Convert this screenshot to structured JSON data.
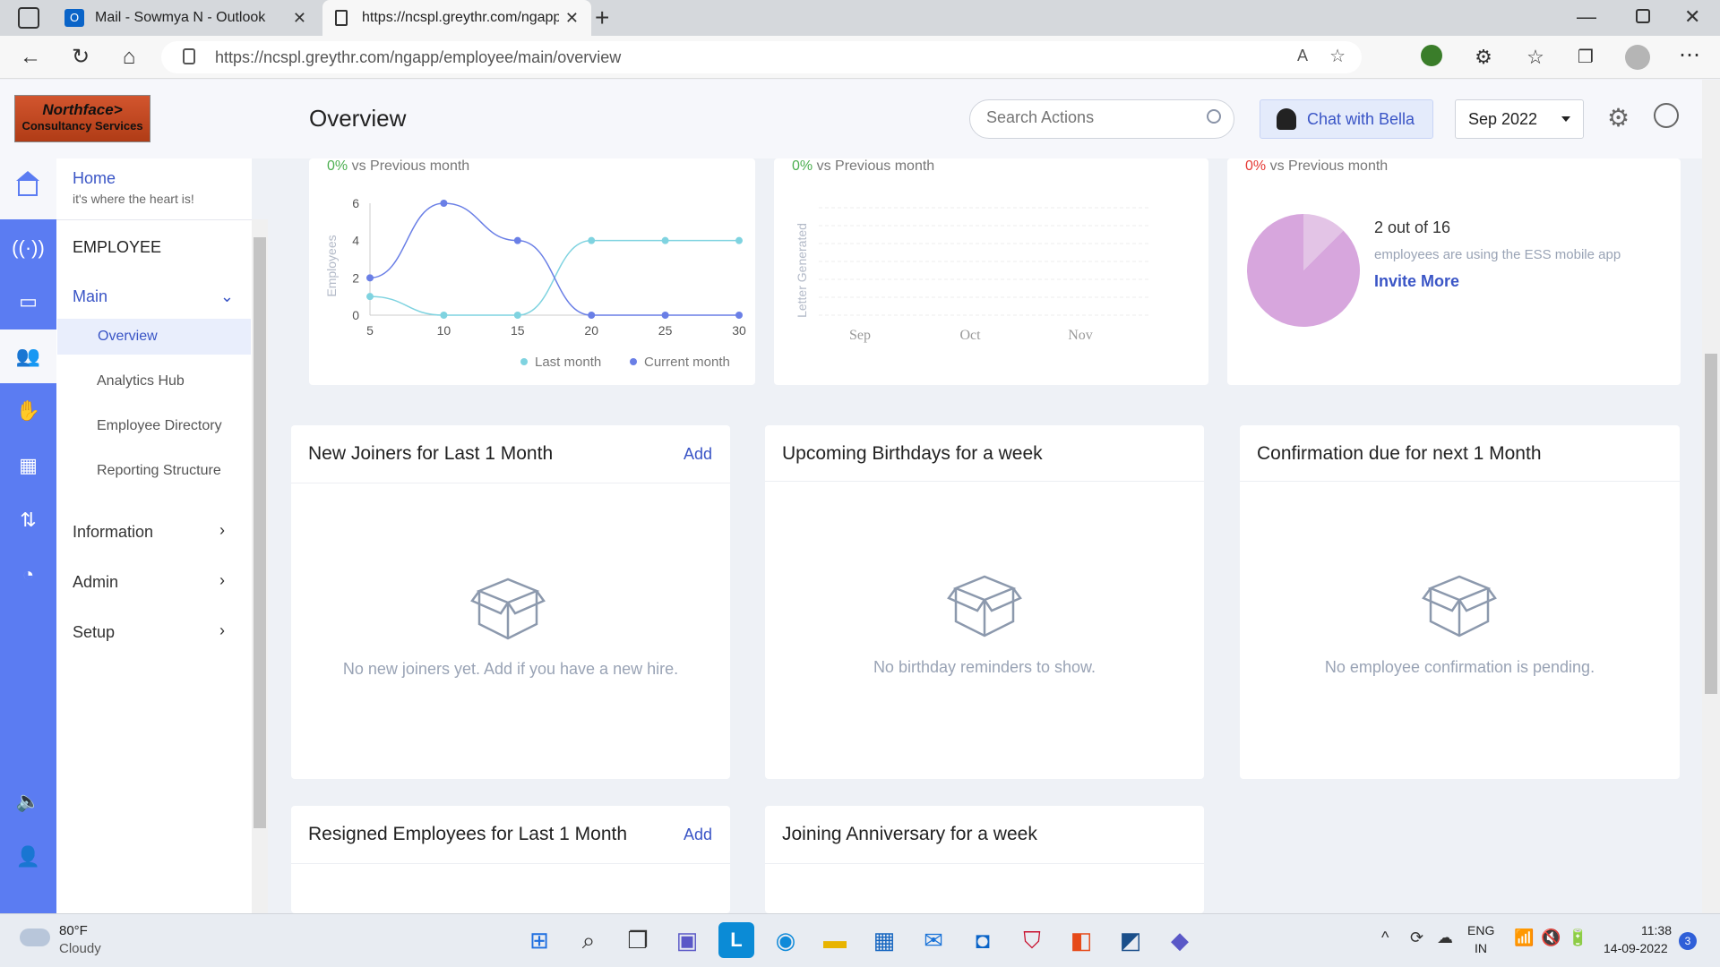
{
  "browser": {
    "tabs": [
      {
        "title": "Mail - Sowmya N - Outlook"
      },
      {
        "title": "https://ncspl.greythr.com/ngapp"
      }
    ],
    "url": "https://ncspl.greythr.com/ngapp/employee/main/overview"
  },
  "header": {
    "logo_line1": "Northface>",
    "logo_line2": "Consultancy Services",
    "title": "Overview",
    "search_placeholder": "Search Actions",
    "chat_label": "Chat with Bella",
    "month_select": "Sep 2022"
  },
  "sidebar": {
    "home_label": "Home",
    "home_sub": "it's where the heart is!",
    "section": "EMPLOYEE",
    "main_label": "Main",
    "items": [
      "Overview",
      "Analytics Hub",
      "Employee Directory",
      "Reporting Structure"
    ],
    "groups": [
      "Information",
      "Admin",
      "Setup"
    ]
  },
  "stats": [
    {
      "pct": "0%",
      "suffix": "vs Previous month",
      "color": "#4caf50"
    },
    {
      "pct": "0%",
      "suffix": "vs Previous month",
      "color": "#4caf50"
    },
    {
      "pct": "0%",
      "suffix": "vs Previous month",
      "color": "#e53935"
    }
  ],
  "chart_data": [
    {
      "type": "line",
      "ylabel": "Employees",
      "x": [
        5,
        10,
        15,
        20,
        25,
        30
      ],
      "yticks": [
        0,
        2,
        4,
        6
      ],
      "ylim": [
        0,
        6
      ],
      "series": [
        {
          "name": "Last month",
          "color": "#7fd3e0",
          "values": [
            1,
            0,
            0,
            4,
            4,
            4
          ]
        },
        {
          "name": "Current month",
          "color": "#6a7fe6",
          "values": [
            2,
            6,
            4,
            0,
            0,
            0
          ]
        }
      ],
      "legend": "bottom-right"
    },
    {
      "type": "bar",
      "ylabel": "Letter Generated",
      "categories": [
        "Sep",
        "Oct",
        "Nov"
      ],
      "values": [
        0,
        0,
        0
      ]
    },
    {
      "type": "pie",
      "slices": [
        {
          "label": "using",
          "value": 2,
          "color": "#e3c4e6"
        },
        {
          "label": "not using",
          "value": 14,
          "color": "#d7a6dd"
        }
      ]
    }
  ],
  "ess": {
    "count": "2 out of 16",
    "desc": "employees are using the ESS mobile app",
    "invite": "Invite More"
  },
  "cards": [
    {
      "title": "New Joiners for Last 1 Month",
      "action": "Add",
      "empty": "No new joiners yet. Add if you have a new hire."
    },
    {
      "title": "Upcoming Birthdays for a week",
      "action": "",
      "empty": "No birthday reminders to show."
    },
    {
      "title": "Confirmation due for next 1 Month",
      "action": "",
      "empty": "No employee confirmation is pending."
    },
    {
      "title": "Resigned Employees for Last 1 Month",
      "action": "Add",
      "empty": ""
    },
    {
      "title": "Joining Anniversary for a week",
      "action": "",
      "empty": ""
    }
  ],
  "taskbar": {
    "temp": "80°F",
    "weather": "Cloudy",
    "lang1": "ENG",
    "lang2": "IN",
    "time": "11:38",
    "date": "14-09-2022",
    "badge": "3"
  }
}
